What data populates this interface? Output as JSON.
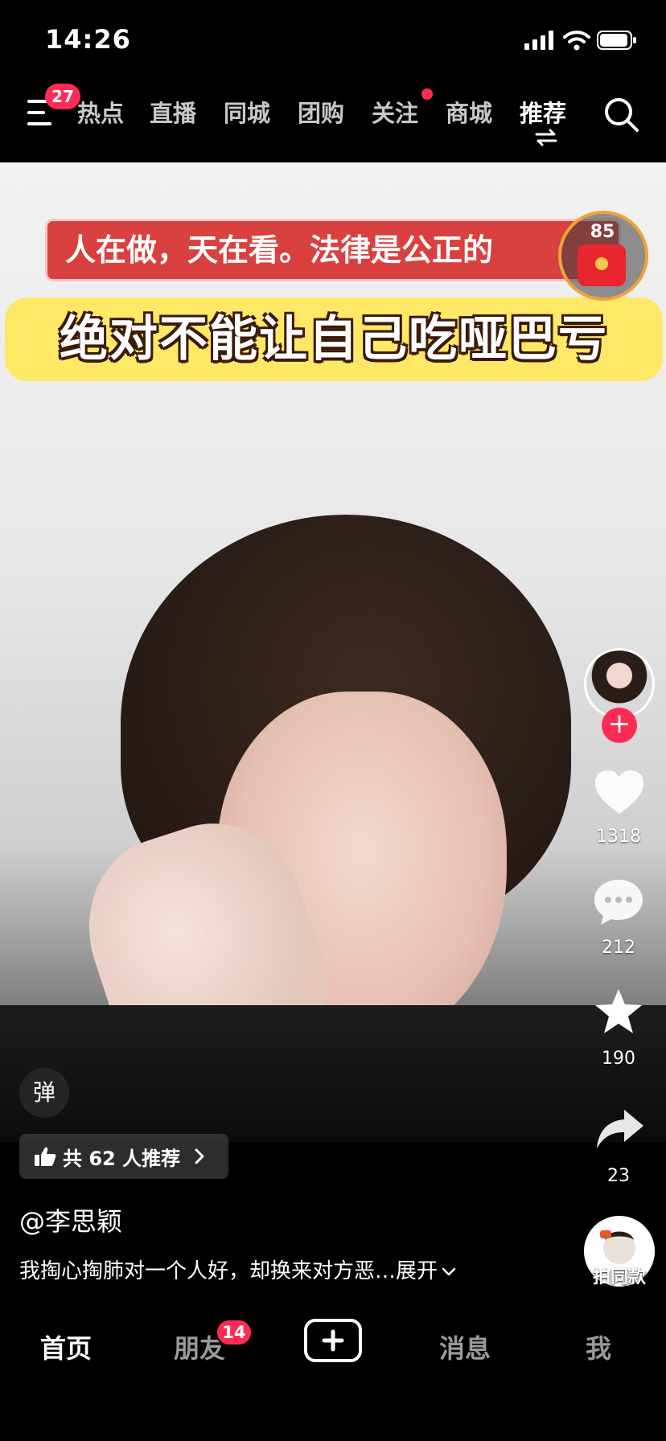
{
  "status_bar": {
    "time": "14:26"
  },
  "top_nav": {
    "menu_badge": "27",
    "tabs": [
      {
        "label": "热点"
      },
      {
        "label": "直播"
      },
      {
        "label": "同城"
      },
      {
        "label": "团购"
      },
      {
        "label": "关注"
      },
      {
        "label": "商城"
      },
      {
        "label": "推荐"
      }
    ],
    "active_tab": "推荐"
  },
  "video": {
    "caption_top": "人在做，天在看。法律是公正的",
    "caption_main": "绝对不能让自己吃哑巴亏",
    "red_packet_count": "85"
  },
  "actions": {
    "likes": "1318",
    "comments": "212",
    "favorites": "190",
    "shares": "23",
    "follow_symbol": "+"
  },
  "danmaku_label": "弹",
  "recommend": {
    "label": "共 62 人推荐"
  },
  "author": "@李思颖",
  "description": {
    "text": "我掏心掏肺对一个人好，却换来对方恶…",
    "expand": "展开"
  },
  "same_style_label": "拍同款",
  "bottom_tabs": {
    "home": "首页",
    "friends": "朋友",
    "friends_badge": "14",
    "messages": "消息",
    "me": "我"
  },
  "colors": {
    "accent": "#fe2c55",
    "caption_yellow": "#ffe866",
    "caption_red": "#d94040"
  }
}
